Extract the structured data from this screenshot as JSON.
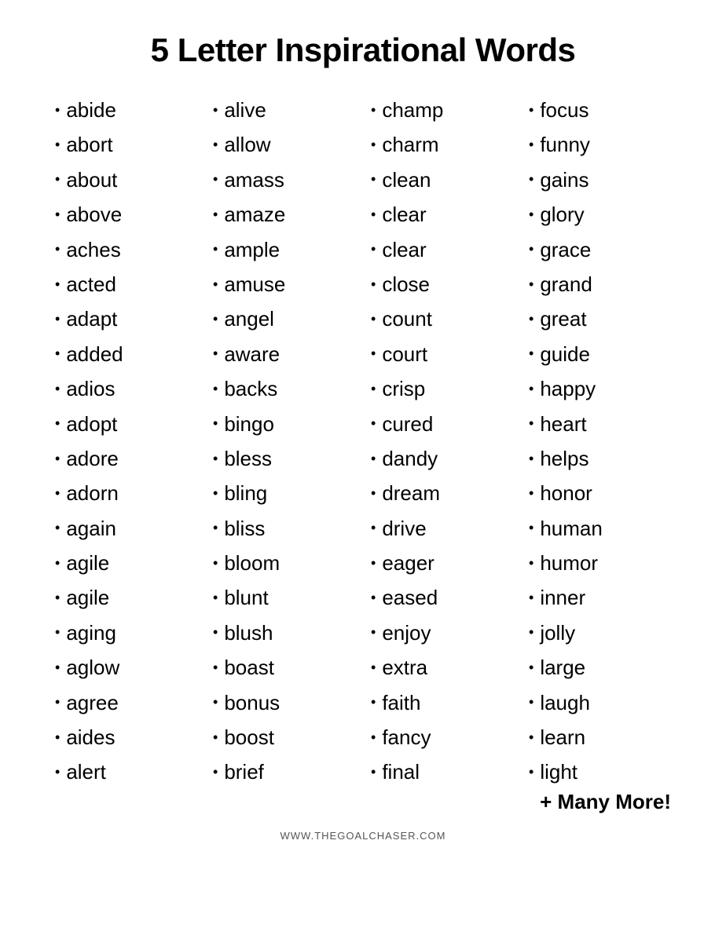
{
  "page": {
    "title": "5 Letter Inspirational Words",
    "website": "WWW.THEGOALCHASER.COM",
    "many_more": "+ Many More!"
  },
  "columns": [
    {
      "id": "col1",
      "words": [
        "abide",
        "abort",
        "about",
        "above",
        "aches",
        "acted",
        "adapt",
        "added",
        "adios",
        "adopt",
        "adore",
        "adorn",
        "again",
        "agile",
        "agile",
        "aging",
        "aglow",
        "agree",
        "aides",
        "alert"
      ]
    },
    {
      "id": "col2",
      "words": [
        "alive",
        "allow",
        "amass",
        "amaze",
        "ample",
        "amuse",
        "angel",
        "aware",
        "backs",
        "bingo",
        "bless",
        "bling",
        "bliss",
        "bloom",
        "blunt",
        "blush",
        "boast",
        "bonus",
        "boost",
        "brief"
      ]
    },
    {
      "id": "col3",
      "words": [
        "champ",
        "charm",
        "clean",
        "clear",
        "clear",
        "close",
        "count",
        "court",
        "crisp",
        "cured",
        "dandy",
        "dream",
        "drive",
        "eager",
        "eased",
        "enjoy",
        "extra",
        "faith",
        "fancy",
        "final"
      ]
    },
    {
      "id": "col4",
      "words": [
        "focus",
        "funny",
        "gains",
        "glory",
        "grace",
        "grand",
        "great",
        "guide",
        "happy",
        "heart",
        "helps",
        "honor",
        "human",
        "humor",
        "inner",
        "jolly",
        "large",
        "laugh",
        "learn",
        "light"
      ]
    }
  ]
}
